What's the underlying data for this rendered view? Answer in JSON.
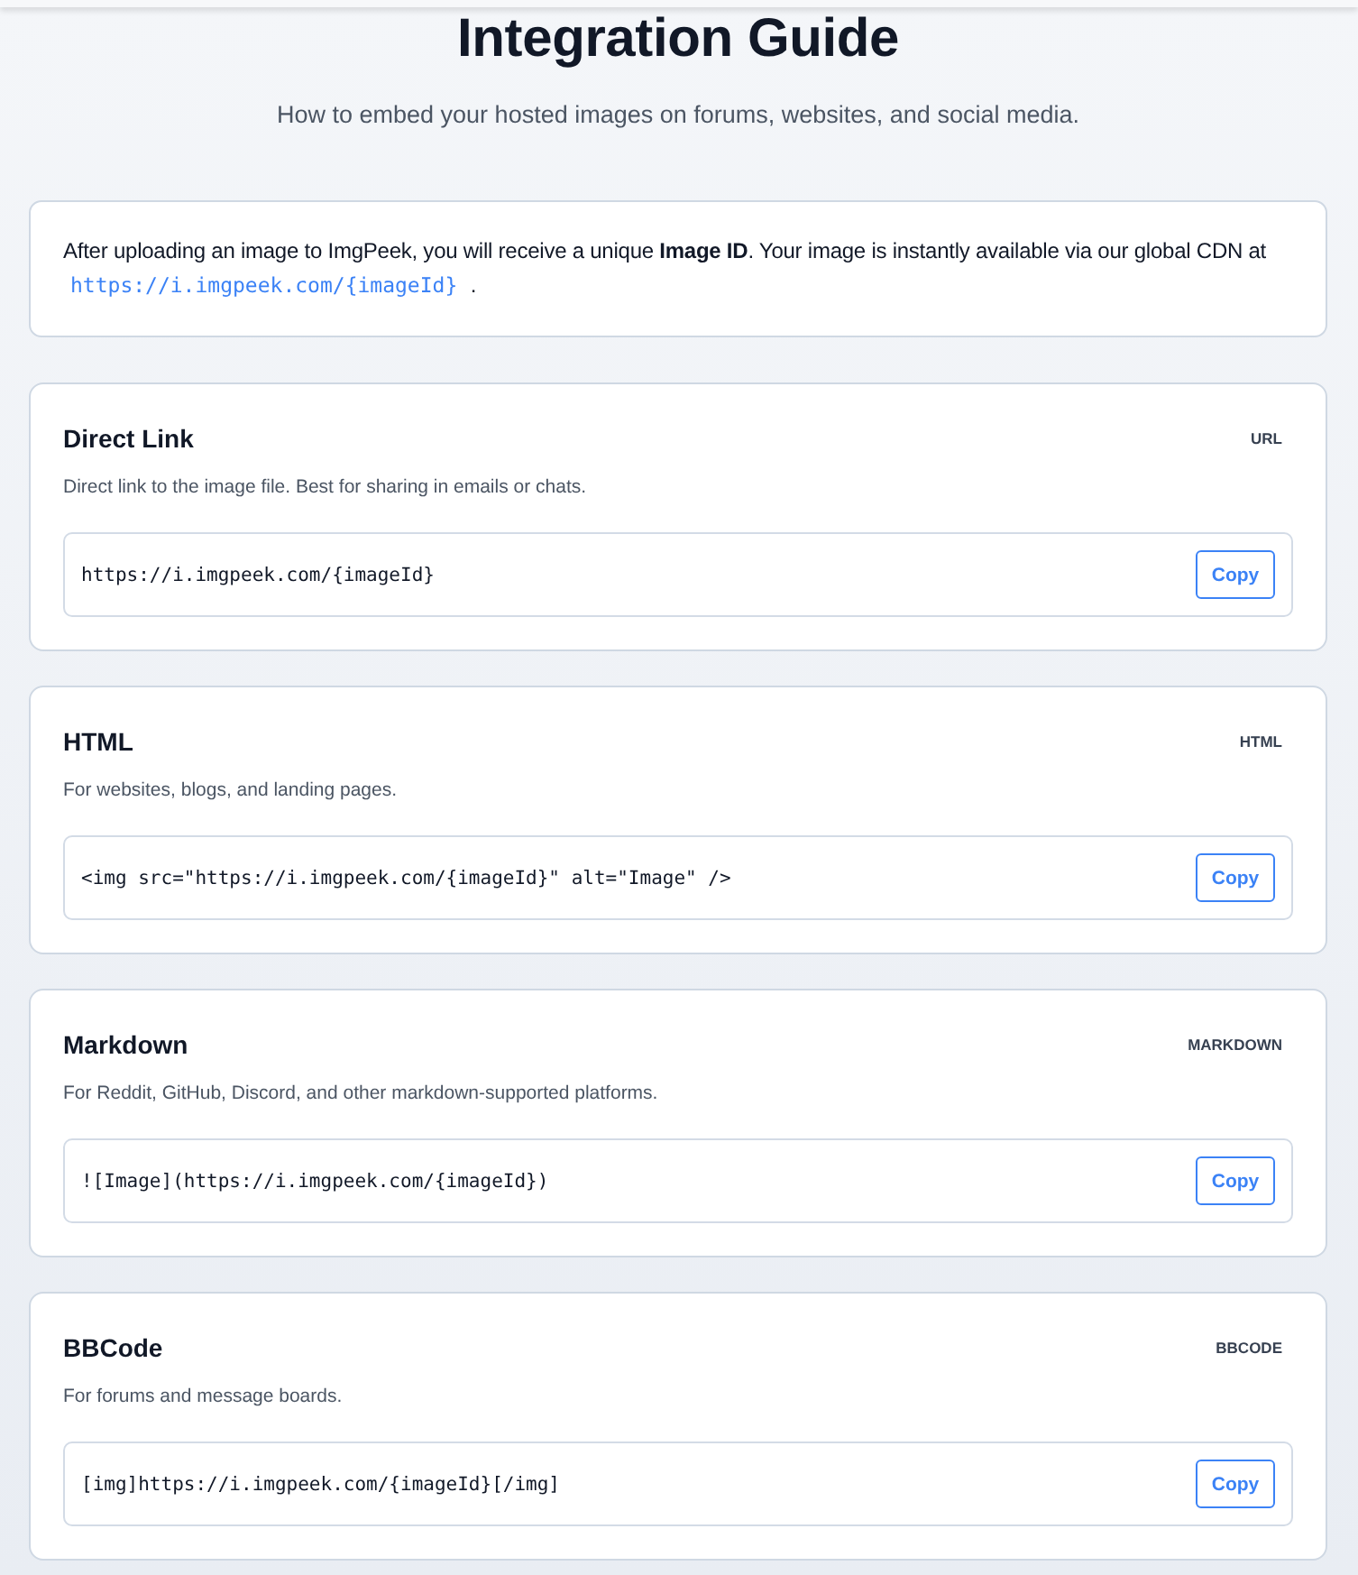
{
  "header": {
    "title": "Integration Guide",
    "subtitle": "How to embed your hosted images on forums, websites, and social media."
  },
  "intro": {
    "text": "After uploading an image to ImgPeek, you will receive a unique **Image ID**. Your image is instantly available via our global CDN at",
    "link": "https://i.imgpeek.com/{imageId}",
    "suffix": "."
  },
  "formats": [
    {
      "title": "Direct Link",
      "badge": "URL",
      "description": "Direct link to the image file. Best for sharing in emails or chats.",
      "code": "https://i.imgpeek.com/{imageId}",
      "button": "Copy"
    },
    {
      "title": "HTML",
      "badge": "HTML",
      "description": "For websites, blogs, and landing pages.",
      "code": "<img src=\"https://i.imgpeek.com/{imageId}\" alt=\"Image\" />",
      "button": "Copy"
    },
    {
      "title": "Markdown",
      "badge": "MARKDOWN",
      "description": "For Reddit, GitHub, Discord, and other markdown-supported platforms.",
      "code": "![Image](https://i.imgpeek.com/{imageId})",
      "button": "Copy"
    },
    {
      "title": "BBCode",
      "badge": "BBCODE",
      "description": "For forums and message boards.",
      "code": "[img]https://i.imgpeek.com/{imageId}[/img]",
      "button": "Copy"
    }
  ]
}
